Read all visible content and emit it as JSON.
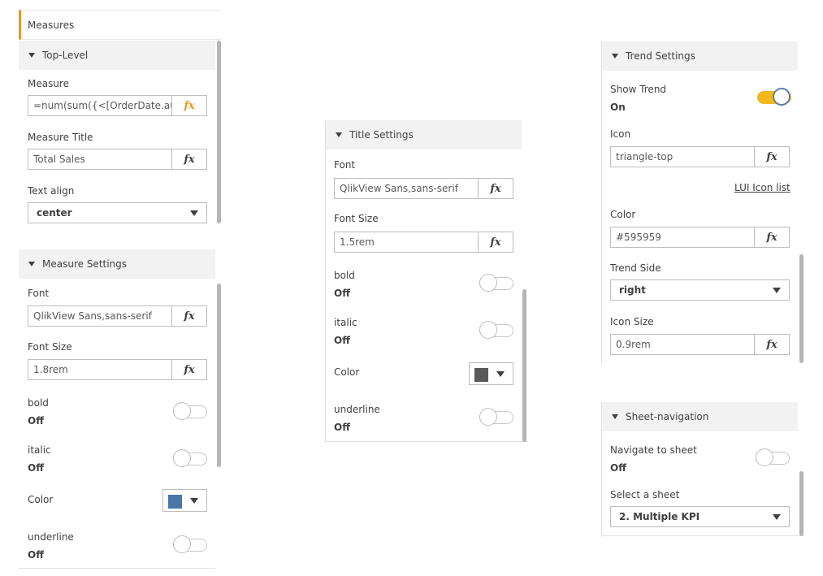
{
  "measures_panel": {
    "tab_label": "Measures",
    "section_header": "Top-Level",
    "measure_label": "Measure",
    "measure_value": "=num(sum({<[OrderDate.auto",
    "measure_title_label": "Measure Title",
    "measure_title_value": "Total Sales",
    "text_align_label": "Text align",
    "text_align_value": "center",
    "fx_label": "fx"
  },
  "measure_settings": {
    "header": "Measure Settings",
    "font_label": "Font",
    "font_value": "QlikView Sans,sans-serif",
    "font_size_label": "Font Size",
    "font_size_value": "1.8rem",
    "bold_label": "bold",
    "bold_state": "Off",
    "italic_label": "italic",
    "italic_state": "Off",
    "color_label": "Color",
    "color_value": "#4a76a8",
    "underline_label": "underline",
    "underline_state": "Off"
  },
  "title_settings": {
    "header": "Title Settings",
    "font_label": "Font",
    "font_value": "QlikView Sans,sans-serif",
    "font_size_label": "Font Size",
    "font_size_value": "1.5rem",
    "bold_label": "bold",
    "bold_state": "Off",
    "italic_label": "italic",
    "italic_state": "Off",
    "color_label": "Color",
    "color_value": "#595959",
    "underline_label": "underline",
    "underline_state": "Off"
  },
  "trend_settings": {
    "header": "Trend Settings",
    "show_trend_label": "Show Trend",
    "show_trend_state": "On",
    "icon_label": "Icon",
    "icon_value": "triangle-top",
    "icon_list_link": "LUI Icon list",
    "color_label": "Color",
    "color_value": "#595959",
    "trend_side_label": "Trend Side",
    "trend_side_value": "right",
    "icon_size_label": "Icon Size",
    "icon_size_value": "0.9rem"
  },
  "sheet_navigation": {
    "header": "Sheet-navigation",
    "navigate_label": "Navigate to sheet",
    "navigate_state": "Off",
    "select_sheet_label": "Select a sheet",
    "select_sheet_value": "2. Multiple KPI"
  },
  "colors": {
    "accent_orange": "#f0931e",
    "toggle_on": "#f2b81e",
    "header_bg": "#f2f2f2"
  }
}
